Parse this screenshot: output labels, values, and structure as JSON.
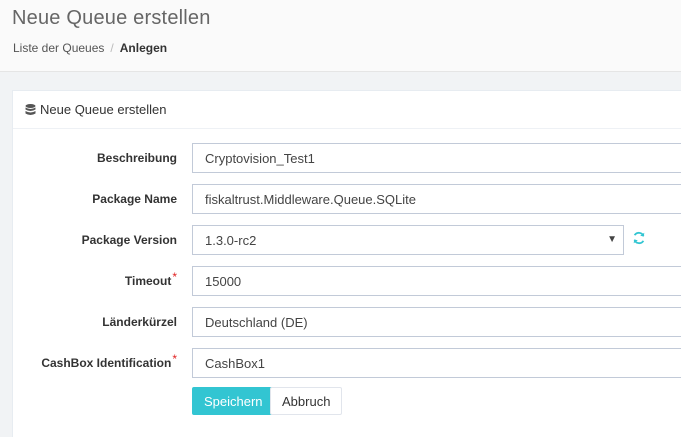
{
  "header": {
    "title": "Neue Queue erstellen",
    "breadcrumb": [
      {
        "label": "Liste der Queues"
      },
      {
        "label": "Anlegen"
      }
    ],
    "breadcrumb_separator": "/"
  },
  "portlet": {
    "caption": "Neue Queue erstellen",
    "caption_icon": "database-icon"
  },
  "form": {
    "beschreibung": {
      "label": "Beschreibung",
      "value": "Cryptovision_Test1"
    },
    "package_name": {
      "label": "Package Name",
      "value": "fiskaltrust.Middleware.Queue.SQLite"
    },
    "package_version": {
      "label": "Package Version",
      "value": "1.3.0-rc2",
      "arrow": "▼",
      "refresh_icon": "refresh-icon"
    },
    "timeout": {
      "label": "Timeout",
      "required_mark": "*",
      "value": "15000"
    },
    "laenderkuerzel": {
      "label": "Länderkürzel",
      "value": "Deutschland (DE)"
    },
    "cashbox_identification": {
      "label": "CashBox Identification",
      "required_mark": "*",
      "value": "CashBox1"
    }
  },
  "actions": {
    "save_label": "Speichern",
    "cancel_label": "Abbruch"
  },
  "colors": {
    "accent": "#32c5d2",
    "required": "#e02222",
    "border": "#c2cad8"
  }
}
